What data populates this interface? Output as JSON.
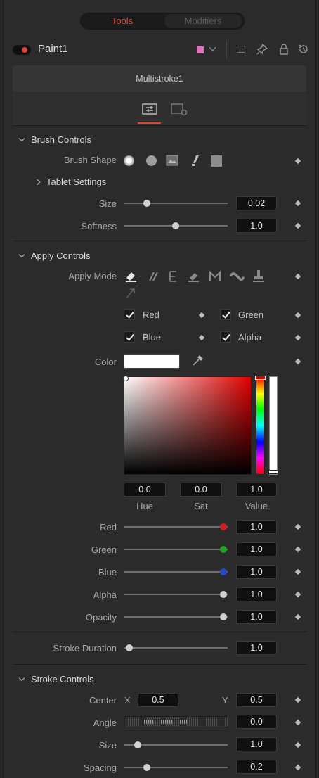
{
  "top_tabs": {
    "tools": "Tools",
    "modifiers": "Modifiers"
  },
  "node": {
    "name": "Paint1",
    "color_swatch": "#e36fc0"
  },
  "header": {
    "tool_name": "Multistroke1"
  },
  "brush_controls": {
    "title": "Brush Controls",
    "brush_shape_label": "Brush Shape",
    "brush_shapes": [
      "soft-brush-icon",
      "circle-brush-icon",
      "image-brush-icon",
      "single-pixel-brush-icon",
      "square-brush-icon"
    ],
    "tablet_settings": "Tablet Settings",
    "size": {
      "label": "Size",
      "value": "0.02",
      "fraction": 0.2
    },
    "softness": {
      "label": "Softness",
      "value": "1.0",
      "fraction": 0.5
    }
  },
  "apply_controls": {
    "title": "Apply Controls",
    "apply_mode_label": "Apply Mode",
    "apply_modes": [
      "color-mode-icon",
      "clone-mode-icon",
      "emboss-mode-icon",
      "erase-mode-icon",
      "merge-mode-icon",
      "smear-mode-icon",
      "stamp-mode-icon",
      "wire-mode-icon"
    ],
    "channels": {
      "red": "Red",
      "green": "Green",
      "blue": "Blue",
      "alpha": "Alpha"
    },
    "color_label": "Color",
    "hue": {
      "label": "Hue",
      "value": "0.0"
    },
    "sat": {
      "label": "Sat",
      "value": "0.0"
    },
    "val": {
      "label": "Value",
      "value": "1.0"
    },
    "red": {
      "label": "Red",
      "value": "1.0",
      "dot": "#cc1f1f"
    },
    "green": {
      "label": "Green",
      "value": "1.0",
      "dot": "#1fa51f"
    },
    "blue": {
      "label": "Blue",
      "value": "1.0",
      "dot": "#2048c8"
    },
    "alpha": {
      "label": "Alpha",
      "value": "1.0"
    },
    "opacity": {
      "label": "Opacity",
      "value": "1.0"
    }
  },
  "stroke_duration": {
    "label": "Stroke Duration",
    "value": "1.0",
    "fraction": 0.0
  },
  "stroke_controls": {
    "title": "Stroke Controls",
    "center_label": "Center",
    "center_x_label": "X",
    "center_x": "0.5",
    "center_y_label": "Y",
    "center_y": "0.5",
    "angle": {
      "label": "Angle",
      "value": "0.0"
    },
    "size": {
      "label": "Size",
      "value": "1.0",
      "fraction": 0.1
    },
    "spacing": {
      "label": "Spacing",
      "value": "0.2",
      "fraction": 0.2
    }
  },
  "colors": {
    "accent": "#e0453a",
    "active_tab": "#5a1a15"
  }
}
